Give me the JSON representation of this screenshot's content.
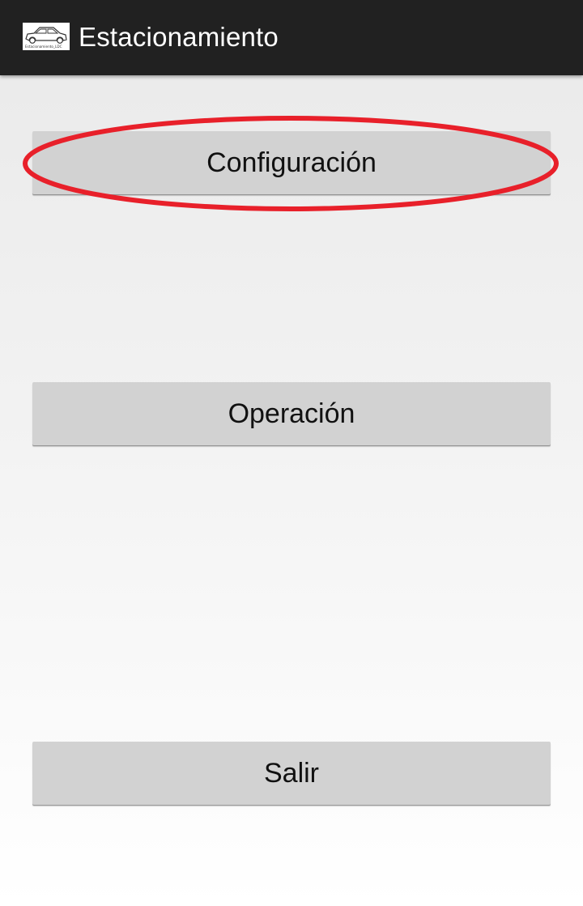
{
  "action_bar": {
    "title": "Estacionamiento",
    "icon": "car-icon",
    "icon_caption": "Estacionamiento_LDC",
    "background_color": "#212121"
  },
  "main": {
    "buttons": [
      {
        "label": "Configuración"
      },
      {
        "label": "Operación"
      },
      {
        "label": "Salir"
      }
    ],
    "highlight_color": "#e8202a"
  }
}
